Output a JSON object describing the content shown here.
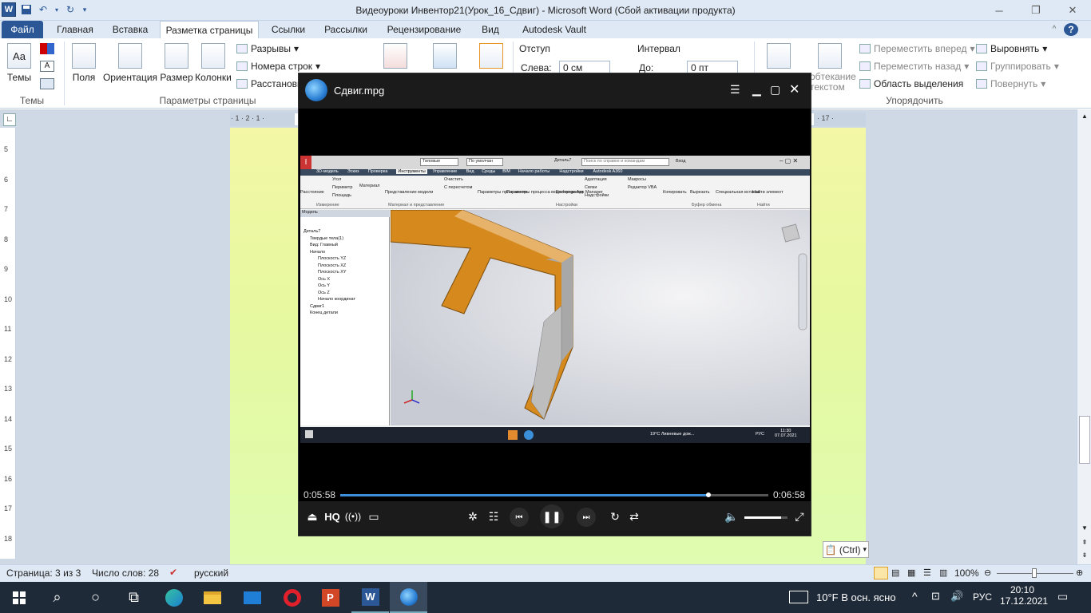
{
  "window": {
    "title": "Видеоуроки Инвентор21(Урок_16_Сдвиг)  -  Microsoft Word (Сбой активации продукта)",
    "logo": "W"
  },
  "ribbon_tabs": [
    "Файл",
    "Главная",
    "Вставка",
    "Разметка страницы",
    "Ссылки",
    "Рассылки",
    "Рецензирование",
    "Вид",
    "Autodesk Vault"
  ],
  "ribbon": {
    "themes": {
      "label": "Темы",
      "group": "Темы"
    },
    "page_setup": {
      "fields": "Поля",
      "orientation": "Ориентация",
      "size": "Размер",
      "columns": "Колонки",
      "breaks": "Разрывы",
      "line_numbers": "Номера строк",
      "hyphenation": "Расстановка",
      "group": "Параметры страницы"
    },
    "indent": {
      "title": "Отступ",
      "left_label": "Слева:",
      "left_value": "0 см"
    },
    "spacing": {
      "title": "Интервал",
      "before_label": "До:",
      "before_value": "0 пт"
    },
    "wrap_text": "обтекание текстом",
    "arrange": {
      "forward": "Переместить вперед",
      "backward": "Переместить назад",
      "selection_pane": "Область выделения",
      "align": "Выровнять",
      "group_obj": "Группировать",
      "rotate": "Повернуть",
      "group": "Упорядочить"
    }
  },
  "ruler": {
    "top_left": "· 1 · 2 · 1 ·",
    "top_right": "· 17 ·",
    "left_ticks": [
      "5",
      "6",
      "7",
      "8",
      "9",
      "10",
      "11",
      "12",
      "13",
      "14",
      "15",
      "16",
      "17",
      "18"
    ]
  },
  "status": {
    "page": "Страница: 3 из 3",
    "words": "Число слов: 28",
    "language": "русский",
    "zoom": "100%"
  },
  "paste_hint": "(Ctrl)",
  "player": {
    "title": "Сдвиг.mpg",
    "time_elapsed": "0:05:58",
    "time_total": "0:06:58",
    "progress": 0.86,
    "volume": 0.85,
    "hq": "HQ"
  },
  "inventor": {
    "part_tab": "Деталь7",
    "search_placeholder": "Поиск по справке и командам",
    "login": "Вход",
    "style_dropdown": "Типовые",
    "material_dropdown": "По умолчан",
    "tabs": [
      "3D-модель",
      "Эскиз",
      "Проверка",
      "Инструменты",
      "Управление",
      "Вид",
      "Среды",
      "BIM",
      "Начало работы",
      "Надстройки",
      "Autodesk A360"
    ],
    "buttons": [
      "Расстояние",
      "Угол",
      "Периметр",
      "Площадь",
      "Материал",
      "Представление модели",
      "Очистить",
      "С пересчетом",
      "Параметры приложения",
      "Параметры процесса моделирования",
      "Exchange App Manager",
      "Адаптация",
      "Связи",
      "Надстройки",
      "Макросы",
      "Редактор VBA",
      "Копировать",
      "Вырезать",
      "Специальная вставка",
      "Найти элемент"
    ],
    "groups": [
      "Измерение",
      "Материал и представление",
      "Настройки",
      "Буфер обмена",
      "Найти"
    ],
    "browser_title": "Модель",
    "tree": [
      "Деталь7",
      "Твердые тела(1)",
      "Вид: Главный",
      "Начало",
      "Плоскость YZ",
      "Плоскость XZ",
      "Плоскость XY",
      "Ось X",
      "Ось Y",
      "Ось Z",
      "Начало координат",
      "Сдвиг1",
      "Конец детали"
    ],
    "taskbar_weather": "19°C  Ливневые дож...",
    "taskbar_lang": "РУС",
    "taskbar_time": "11:30",
    "taskbar_date": "07.07.2021"
  },
  "taskbar": {
    "weather": "10°F  В осн. ясно",
    "lang": "РУС",
    "time": "20:10",
    "date": "17.12.2021"
  },
  "colors": {
    "word_blue": "#2b5797",
    "part_orange": "#d68a1e",
    "taskbar": "#1f2a38",
    "progress": "#3d8fd8"
  }
}
